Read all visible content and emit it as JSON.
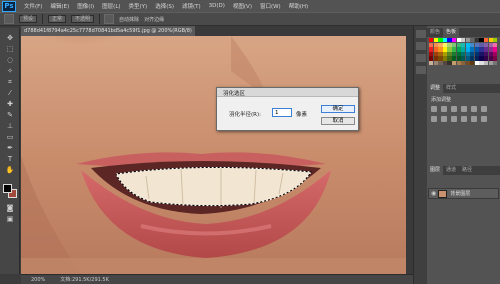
{
  "app": {
    "logo": "Ps"
  },
  "menu": {
    "items": [
      "文件(F)",
      "编辑(E)",
      "图像(I)",
      "图层(L)",
      "类型(Y)",
      "选择(S)",
      "滤镜(T)",
      "3D(D)",
      "视图(V)",
      "窗口(W)",
      "帮助(H)"
    ]
  },
  "options": {
    "brush_preset": "预设",
    "mode": "正常",
    "opacity": "不透明",
    "auto_erase": "自动抹除",
    "extra": "对齐边缘"
  },
  "document": {
    "tab_title": "d788d41f8794a4c25c7778d70841bd5a4c59f1.jpg @ 200%(RGB/8)"
  },
  "status": {
    "zoom": "200%",
    "doc_size": "文档:291.5K/291.5K"
  },
  "panels": {
    "color_tabs": [
      "颜色",
      "色板"
    ],
    "adjust_tabs": [
      "调整",
      "样式"
    ],
    "adjust_title": "添加调整",
    "layers_tabs": [
      "图层",
      "通道",
      "路径"
    ],
    "layer_name": "背景图层",
    "swatch_colors": [
      "#ff0000",
      "#ffff00",
      "#00ff00",
      "#00ffff",
      "#0000ff",
      "#ff00ff",
      "#ffffff",
      "#cccccc",
      "#999999",
      "#666666",
      "#333333",
      "#000000",
      "#ff6633",
      "#ffcc00",
      "#99cc00",
      "#f26c4f",
      "#f68e55",
      "#fbaf5c",
      "#fff467",
      "#acd372",
      "#7cc576",
      "#3bb878",
      "#1abbb4",
      "#00bff3",
      "#438ccb",
      "#5574b9",
      "#605ca8",
      "#855fa8",
      "#a763a8",
      "#f06ea9",
      "#ed1c24",
      "#f26522",
      "#f7941d",
      "#fff200",
      "#8dc63f",
      "#39b54a",
      "#00a651",
      "#00a99d",
      "#00aeef",
      "#0072bc",
      "#0054a6",
      "#2e3192",
      "#662d91",
      "#92278f",
      "#ec008c",
      "#9e0b0f",
      "#a0410d",
      "#a36209",
      "#aba000",
      "#598527",
      "#1a7b30",
      "#007236",
      "#00746b",
      "#0076a3",
      "#004b80",
      "#003471",
      "#1b1464",
      "#440e62",
      "#630460",
      "#9e005d",
      "#790000",
      "#7b2e00",
      "#7d4900",
      "#827b00",
      "#406618",
      "#005e20",
      "#005826",
      "#005952",
      "#005b7f",
      "#003663",
      "#002157",
      "#0d004c",
      "#32004b",
      "#4b0049",
      "#7b0046",
      "#c7b299",
      "#998675",
      "#736357",
      "#534741",
      "#37302a",
      "#c69c6d",
      "#a67c52",
      "#8c6239",
      "#754c24",
      "#603913",
      "#ffffff",
      "#e0e0e0",
      "#bdbdbd",
      "#9e9e9e",
      "#757575"
    ]
  },
  "dialog": {
    "title": "羽化选区",
    "feather_label": "羽化半径(R):",
    "feather_value": "1",
    "unit": "像素",
    "ok": "确定",
    "cancel": "取消",
    "accent_color": "#3b7fd6"
  }
}
